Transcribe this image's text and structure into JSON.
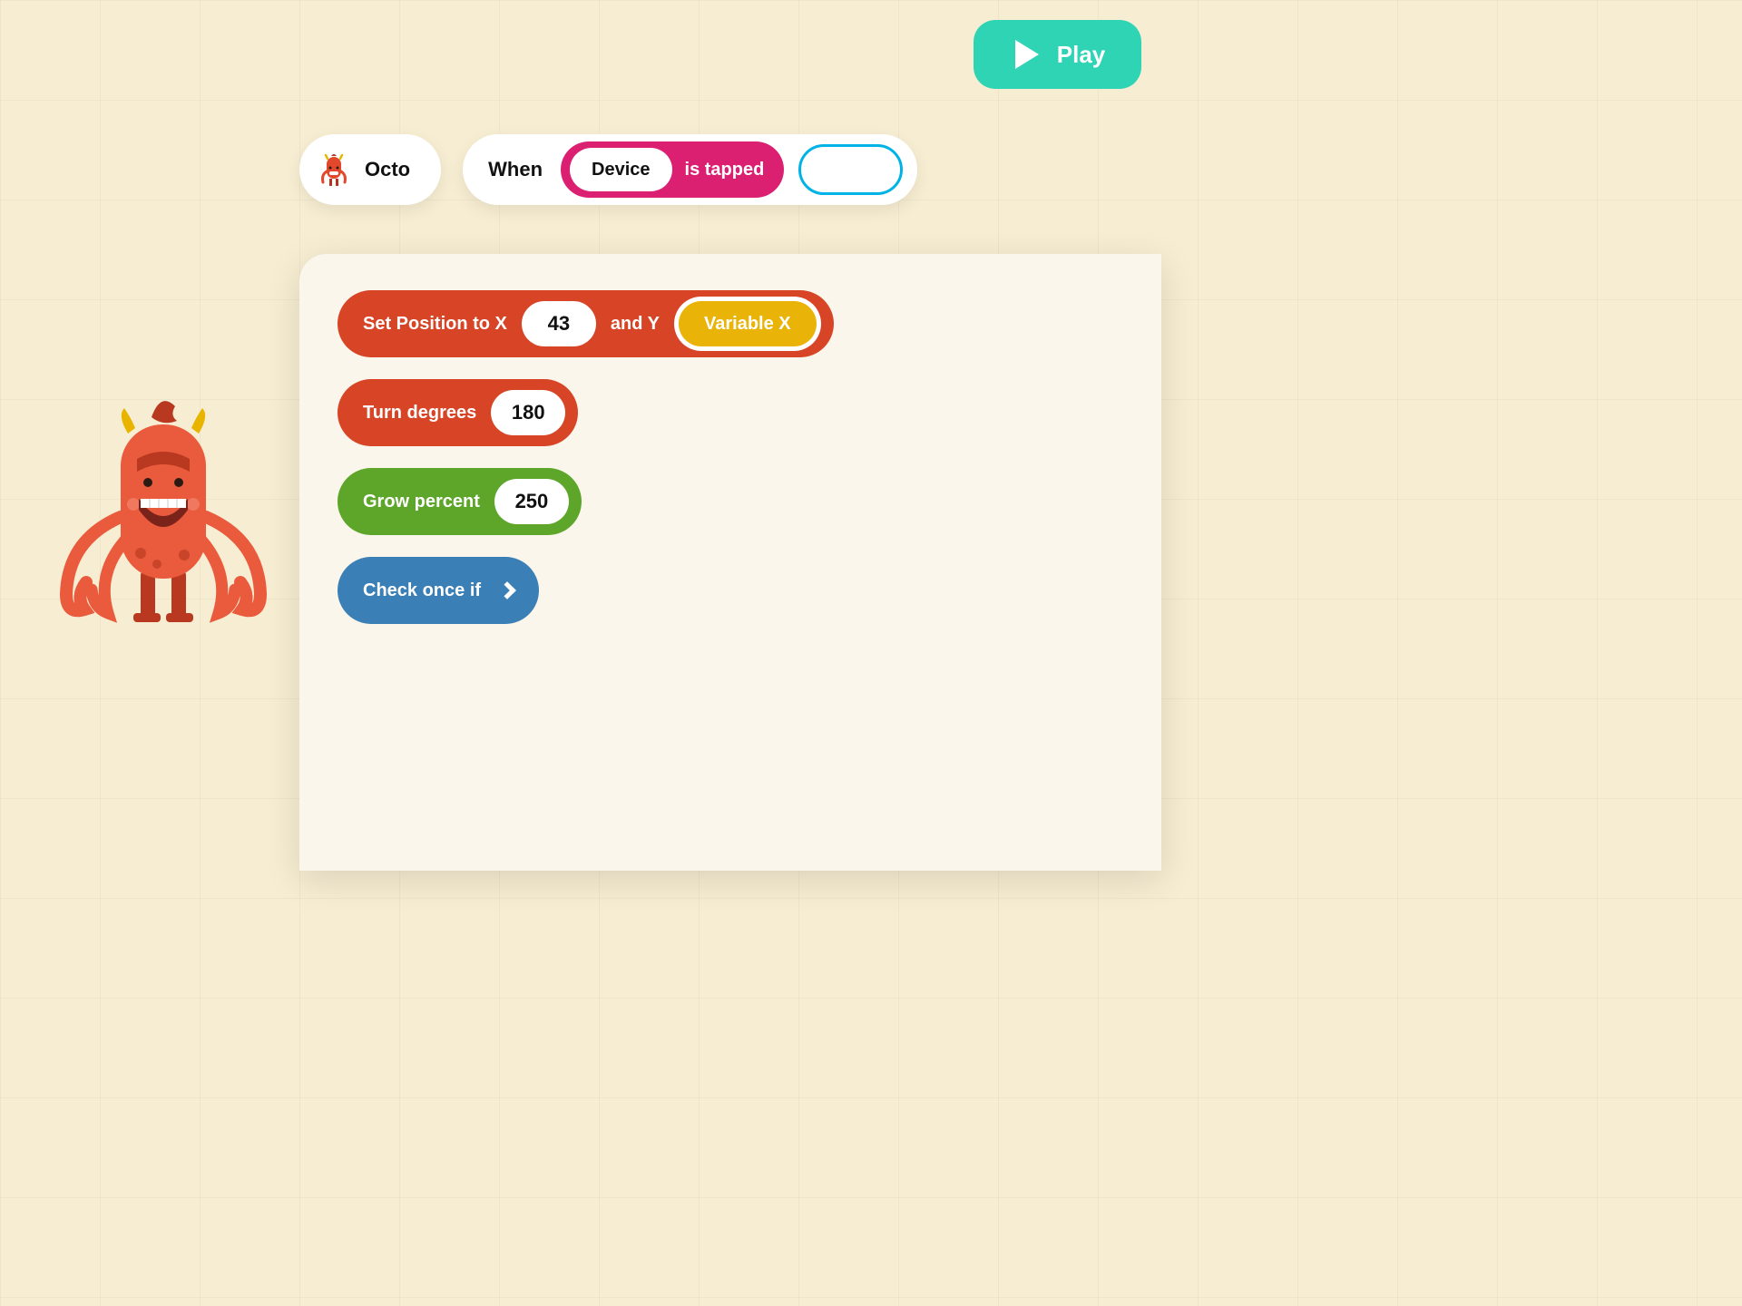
{
  "play_button": {
    "label": "Play"
  },
  "object_chip": {
    "name": "Octo"
  },
  "when_block": {
    "prefix": "When",
    "device_label": "Device",
    "action_label": "is tapped"
  },
  "blocks": {
    "set_position": {
      "label_1": "Set Position to X",
      "x_value": "43",
      "label_2": "and Y",
      "y_variable": "Variable X"
    },
    "turn": {
      "label": "Turn degrees",
      "value": "180"
    },
    "grow": {
      "label": "Grow percent",
      "value": "250"
    },
    "check_if": {
      "label": "Check once if"
    }
  },
  "colors": {
    "play": "#2fd4b5",
    "pink": "#db2072",
    "red_block": "#d74426",
    "green_block": "#5ea62a",
    "blue_block": "#3a7fb5",
    "yellow_var": "#eab308",
    "slot_border": "#00b3e6"
  }
}
